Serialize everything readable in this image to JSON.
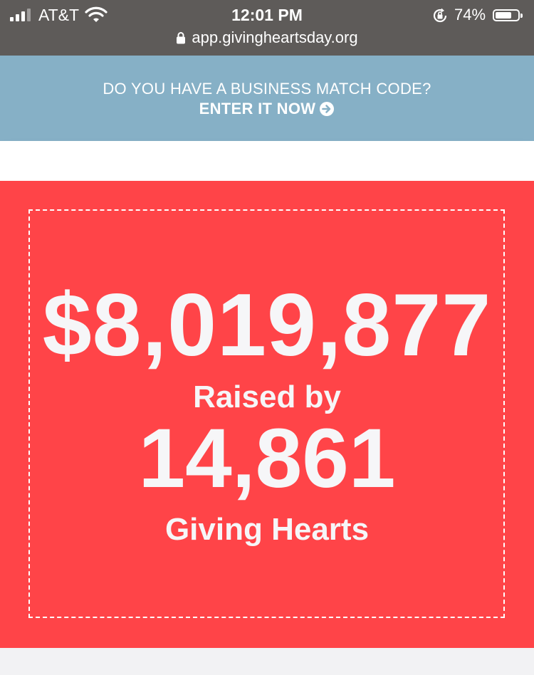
{
  "status_bar": {
    "carrier": "AT&T",
    "time": "12:01 PM",
    "battery_percent": "74%",
    "battery_level": 0.74,
    "url": "app.givingheartsday.org"
  },
  "banner": {
    "question": "DO YOU HAVE A BUSINESS MATCH CODE?",
    "cta_label": "ENTER IT NOW",
    "background_color": "#86b0c6"
  },
  "stats": {
    "amount_raised": "$8,019,877",
    "raised_by_label": "Raised by",
    "donor_count": "14,861",
    "donor_label": "Giving Hearts",
    "card_color": "#ff4448"
  }
}
